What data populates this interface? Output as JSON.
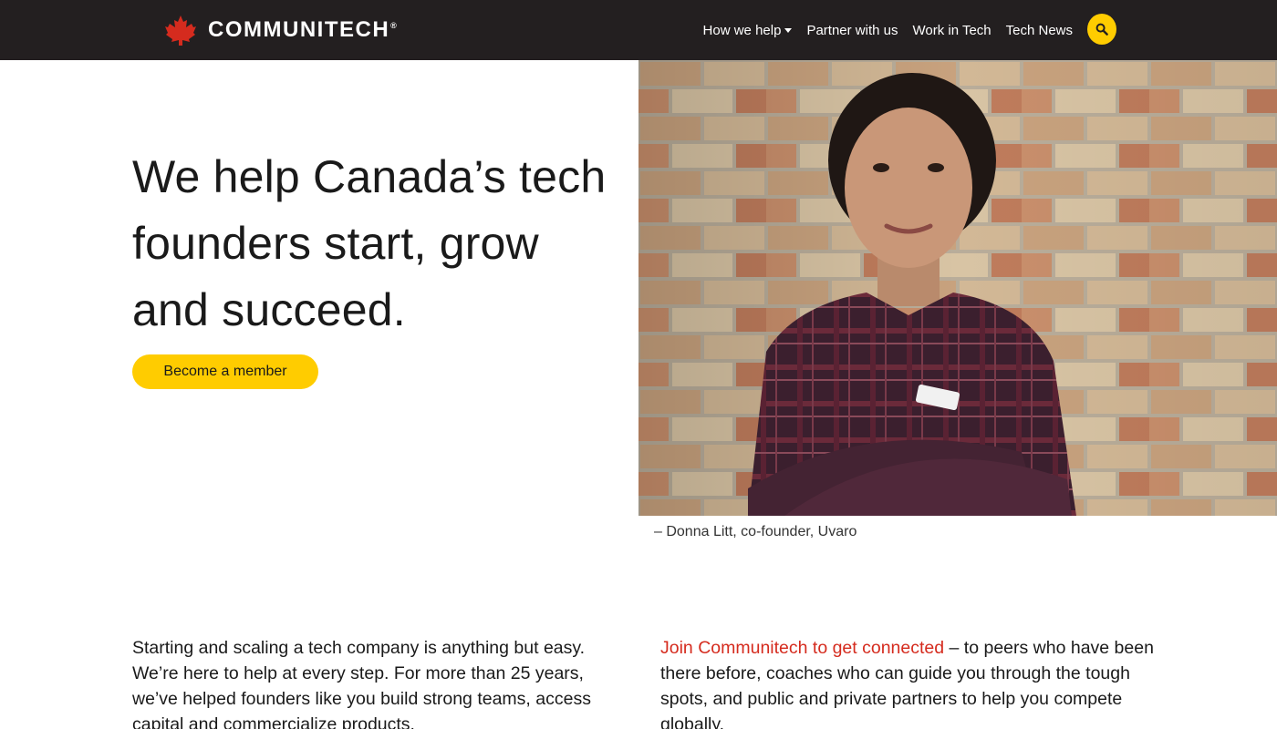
{
  "brand": {
    "name": "COMMUNITECH",
    "registered": "®"
  },
  "nav": {
    "items": [
      {
        "label": "How we help",
        "has_dropdown": true
      },
      {
        "label": "Partner with us",
        "has_dropdown": false
      },
      {
        "label": "Work in Tech",
        "has_dropdown": false
      },
      {
        "label": "Tech News",
        "has_dropdown": false
      }
    ],
    "search_icon": "search-icon"
  },
  "hero": {
    "line1": "We help Canada’s tech",
    "line2": "founders start, grow",
    "line3": "and succeed.",
    "cta_label": "Become a member",
    "caption": "– Donna Litt, co-founder, Uvaro"
  },
  "intro": {
    "left_text": "Starting and scaling a tech company is anything but easy. We’re here to help at every step. For more than 25 years, we’ve helped founders like you build strong teams, access capital and commercialize products.",
    "right_link": "Join Communitech to get connected",
    "right_text": " – to peers who have been there before, coaches who can guide you through the tough spots, and public and private partners to help you compete globally."
  },
  "colors": {
    "navbar_bg": "#231f20",
    "accent_yellow": "#ffcc00",
    "brand_red": "#d52b1e",
    "text": "#1a1a1a"
  }
}
